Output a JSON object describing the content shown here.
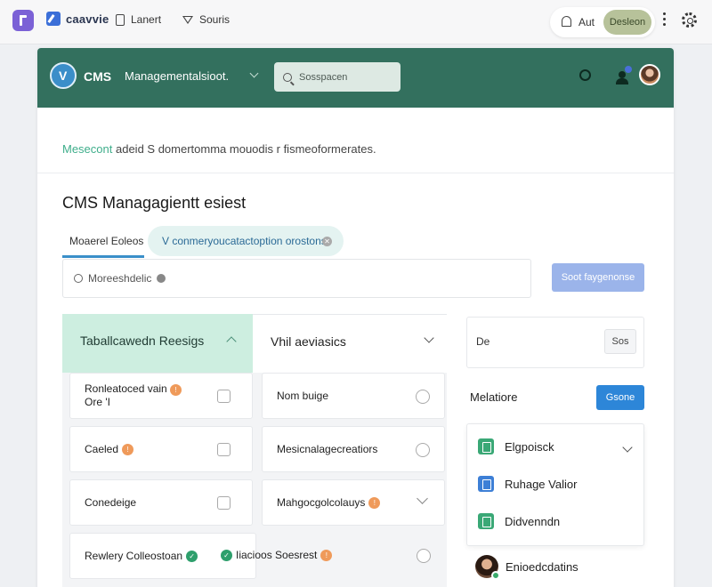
{
  "topbar": {
    "brand_label": "caavvie",
    "nav": [
      {
        "label": "Lanert",
        "icon": "document-icon"
      },
      {
        "label": "Souris",
        "icon": "filter-icon"
      }
    ],
    "aut_label": "Aut",
    "pill_label": "Desleon"
  },
  "header": {
    "cms_label": "CMS",
    "title": "Managementalsioot.",
    "search_placeholder": "Sosspacen",
    "notification_dot_color": "#4a6fd9",
    "background_color": "#33705e"
  },
  "subtitle": {
    "accent": "Mesecont",
    "rest": " adeid S domertomma mouodis r fismeoformerates."
  },
  "page_title": "CMS Managagientt esiest",
  "tabs": [
    {
      "label": "Moaerel Eoleos"
    },
    {
      "label": "V conmeryoucatactoption orostons"
    }
  ],
  "filter": {
    "value": "Moreeshdelic"
  },
  "filter_button_label": "Soot faygenonse",
  "columns": [
    {
      "title": "Taballcawedn Reesigs",
      "items": [
        {
          "label": "Ronleatoced vain",
          "label_line2": "Ore 'I",
          "badge": "orange"
        },
        {
          "label": "Caeled",
          "badge": "orange"
        },
        {
          "label": "Conedeige",
          "badge": ""
        },
        {
          "label": "Rewlery Colleostoan",
          "badge": "green"
        }
      ]
    },
    {
      "title": "Vhil aeviasics",
      "items": [
        {
          "label": "Nom buige",
          "badge": ""
        },
        {
          "label": "Mesicnalagecreatiors",
          "badge": ""
        },
        {
          "label": "Mahgocgolcolauys",
          "badge": "orange"
        },
        {
          "label": "Iiacioos Soesrest",
          "badge": "orange",
          "prefix_badge": "green"
        }
      ]
    }
  ],
  "right_panel": {
    "input_label": "De",
    "input_button": "Sos",
    "section_label": "Melatiore",
    "section_button": "Gsone",
    "menu": [
      {
        "label": "Elgpoisck",
        "icon": "document-icon",
        "color": "#3aa876"
      },
      {
        "label": "Ruhage Valior",
        "icon": "clipboard-icon",
        "color": "#3d7fd6"
      },
      {
        "label": "Didvenndn",
        "icon": "document-icon",
        "color": "#3aa876"
      }
    ],
    "profile_name": "Enioedcdatins"
  }
}
